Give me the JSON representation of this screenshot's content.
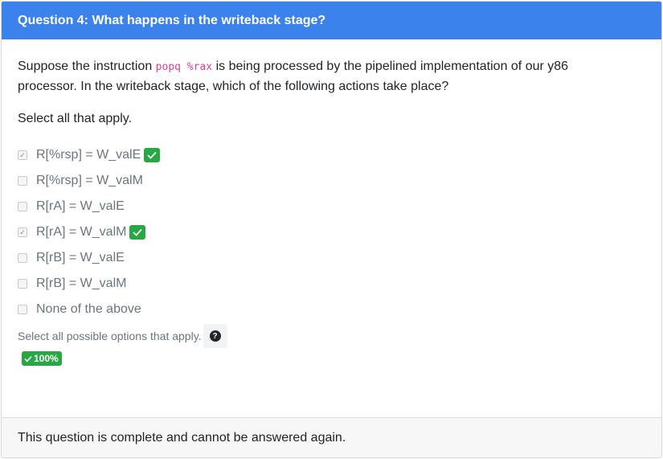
{
  "header": {
    "title": "Question 4: What happens in the writeback stage?"
  },
  "prompt": {
    "before": "Suppose the instruction ",
    "code": "popq %rax",
    "after": " is being processed by the pipelined implementation of our y86 processor. In the writeback stage, which of the following actions take place?"
  },
  "instruction": "Select all that apply.",
  "options": [
    {
      "label": "R[%rsp] = W_valE",
      "checked": true,
      "correct": true
    },
    {
      "label": "R[%rsp] = W_valM",
      "checked": false,
      "correct": false
    },
    {
      "label": "R[rA] = W_valE",
      "checked": false,
      "correct": false
    },
    {
      "label": "R[rA] = W_valM",
      "checked": true,
      "correct": true
    },
    {
      "label": "R[rB] = W_valE",
      "checked": false,
      "correct": false
    },
    {
      "label": "R[rB] = W_valM",
      "checked": false,
      "correct": false
    },
    {
      "label": "None of the above",
      "checked": false,
      "correct": false
    }
  ],
  "hint": "Select all possible options that apply.",
  "help_icon": "question-circle-icon",
  "score": "100%",
  "footer": "This question is complete and cannot be answered again.",
  "colors": {
    "header": "#3c82ed",
    "correct": "#28a745",
    "code": "#e83e8c"
  }
}
